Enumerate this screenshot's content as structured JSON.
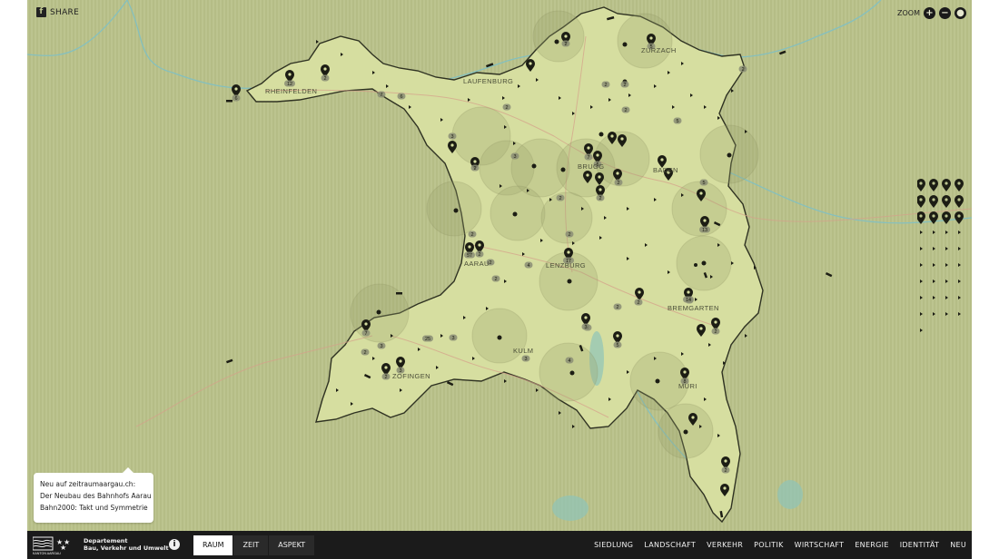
{
  "header": {
    "share_label": "SHARE",
    "zoom_label": "ZOOM",
    "zoom_in_icon": "plus-icon",
    "zoom_out_icon": "minus-icon",
    "view_icon": "eye-icon"
  },
  "map": {
    "places": [
      "RHEINFELDEN",
      "LAUFENBURG",
      "ZURZACH",
      "BRUGG",
      "BADEN",
      "AARAU",
      "LENZBURG",
      "BREMGARTEN",
      "KULM",
      "ZOFINGEN",
      "MURI"
    ],
    "badge_counts": [
      "6",
      "12",
      "2",
      "2",
      "5",
      "7",
      "6",
      "2",
      "2",
      "2",
      "2",
      "5",
      "2",
      "3",
      "2",
      "7",
      "5",
      "3",
      "2",
      "2",
      "2",
      "5",
      "13",
      "2",
      "2",
      "57",
      "2",
      "2",
      "17",
      "4",
      "2",
      "2",
      "2",
      "2",
      "14",
      "4",
      "2",
      "3",
      "5",
      "3",
      "7",
      "3",
      "2",
      "3",
      "8",
      "2",
      "3",
      "25",
      "4",
      "2"
    ],
    "colors": {
      "land": "#d6dea0",
      "background": "#bcc48f",
      "border": "#3a3d2a",
      "water": "#6fb6bd",
      "roads": "#d28b7a"
    }
  },
  "news": {
    "lines": [
      "Neu auf zeitraumaargau.ch:",
      "Der Neubau des Bahnhofs Aarau",
      "Bahn2000: Takt und Symmetrie"
    ]
  },
  "footer": {
    "logo_text": "KANTON AARGAU",
    "department_line1": "Departement",
    "department_line2": "Bau, Verkehr und Umwelt",
    "tabs": [
      "RAUM",
      "ZEIT",
      "ASPEKT"
    ],
    "active_tab": "RAUM",
    "topics": [
      "SIEDLUNG",
      "LANDSCHAFT",
      "VERKEHR",
      "POLITIK",
      "WIRTSCHAFT",
      "ENERGIE",
      "IDENTITÄT",
      "NEU"
    ]
  }
}
